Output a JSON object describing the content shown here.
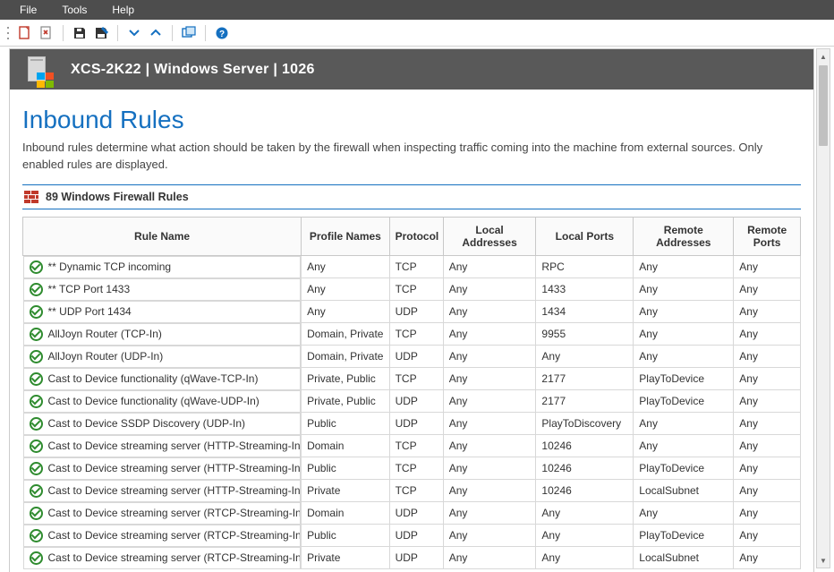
{
  "menu": {
    "file": "File",
    "tools": "Tools",
    "help": "Help"
  },
  "toolbar": {
    "pdf_icon": "pdf",
    "close_icon": "close",
    "save_icon": "save",
    "edit_icon": "edit",
    "down_icon": "down",
    "up_icon": "up",
    "window_icon": "window",
    "help_icon": "help"
  },
  "header": {
    "title": "XCS-2K22 | Windows Server | 1026"
  },
  "page": {
    "title": "Inbound Rules",
    "description": "Inbound rules determine what action should be taken by the firewall when inspecting traffic coming into the machine from external sources. Only enabled rules are displayed."
  },
  "section": {
    "count_label": "89 Windows Firewall Rules"
  },
  "columns": {
    "name": "Rule Name",
    "profiles": "Profile Names",
    "protocol": "Protocol",
    "laddr": "Local Addresses",
    "lport": "Local Ports",
    "raddr": "Remote Addresses",
    "rport": "Remote Ports"
  },
  "rules": [
    {
      "name": "** Dynamic TCP incoming",
      "profiles": "Any",
      "protocol": "TCP",
      "laddr": "Any",
      "lport": "RPC",
      "raddr": "Any",
      "rport": "Any"
    },
    {
      "name": "** TCP Port 1433",
      "profiles": "Any",
      "protocol": "TCP",
      "laddr": "Any",
      "lport": "1433",
      "raddr": "Any",
      "rport": "Any"
    },
    {
      "name": "** UDP Port 1434",
      "profiles": "Any",
      "protocol": "UDP",
      "laddr": "Any",
      "lport": "1434",
      "raddr": "Any",
      "rport": "Any"
    },
    {
      "name": "AllJoyn Router (TCP-In)",
      "profiles": "Domain, Private",
      "protocol": "TCP",
      "laddr": "Any",
      "lport": "9955",
      "raddr": "Any",
      "rport": "Any"
    },
    {
      "name": "AllJoyn Router (UDP-In)",
      "profiles": "Domain, Private",
      "protocol": "UDP",
      "laddr": "Any",
      "lport": "Any",
      "raddr": "Any",
      "rport": "Any"
    },
    {
      "name": "Cast to Device functionality (qWave-TCP-In)",
      "profiles": "Private, Public",
      "protocol": "TCP",
      "laddr": "Any",
      "lport": "2177",
      "raddr": "PlayToDevice",
      "rport": "Any"
    },
    {
      "name": "Cast to Device functionality (qWave-UDP-In)",
      "profiles": "Private, Public",
      "protocol": "UDP",
      "laddr": "Any",
      "lport": "2177",
      "raddr": "PlayToDevice",
      "rport": "Any"
    },
    {
      "name": "Cast to Device SSDP Discovery (UDP-In)",
      "profiles": "Public",
      "protocol": "UDP",
      "laddr": "Any",
      "lport": "PlayToDiscovery",
      "raddr": "Any",
      "rport": "Any"
    },
    {
      "name": "Cast to Device streaming server (HTTP-Streaming-In)",
      "profiles": "Domain",
      "protocol": "TCP",
      "laddr": "Any",
      "lport": "10246",
      "raddr": "Any",
      "rport": "Any"
    },
    {
      "name": "Cast to Device streaming server (HTTP-Streaming-In)",
      "profiles": "Public",
      "protocol": "TCP",
      "laddr": "Any",
      "lport": "10246",
      "raddr": "PlayToDevice",
      "rport": "Any"
    },
    {
      "name": "Cast to Device streaming server (HTTP-Streaming-In)",
      "profiles": "Private",
      "protocol": "TCP",
      "laddr": "Any",
      "lport": "10246",
      "raddr": "LocalSubnet",
      "rport": "Any"
    },
    {
      "name": "Cast to Device streaming server (RTCP-Streaming-In)",
      "profiles": "Domain",
      "protocol": "UDP",
      "laddr": "Any",
      "lport": "Any",
      "raddr": "Any",
      "rport": "Any"
    },
    {
      "name": "Cast to Device streaming server (RTCP-Streaming-In)",
      "profiles": "Public",
      "protocol": "UDP",
      "laddr": "Any",
      "lport": "Any",
      "raddr": "PlayToDevice",
      "rport": "Any"
    },
    {
      "name": "Cast to Device streaming server (RTCP-Streaming-In)",
      "profiles": "Private",
      "protocol": "UDP",
      "laddr": "Any",
      "lport": "Any",
      "raddr": "LocalSubnet",
      "rport": "Any"
    }
  ]
}
